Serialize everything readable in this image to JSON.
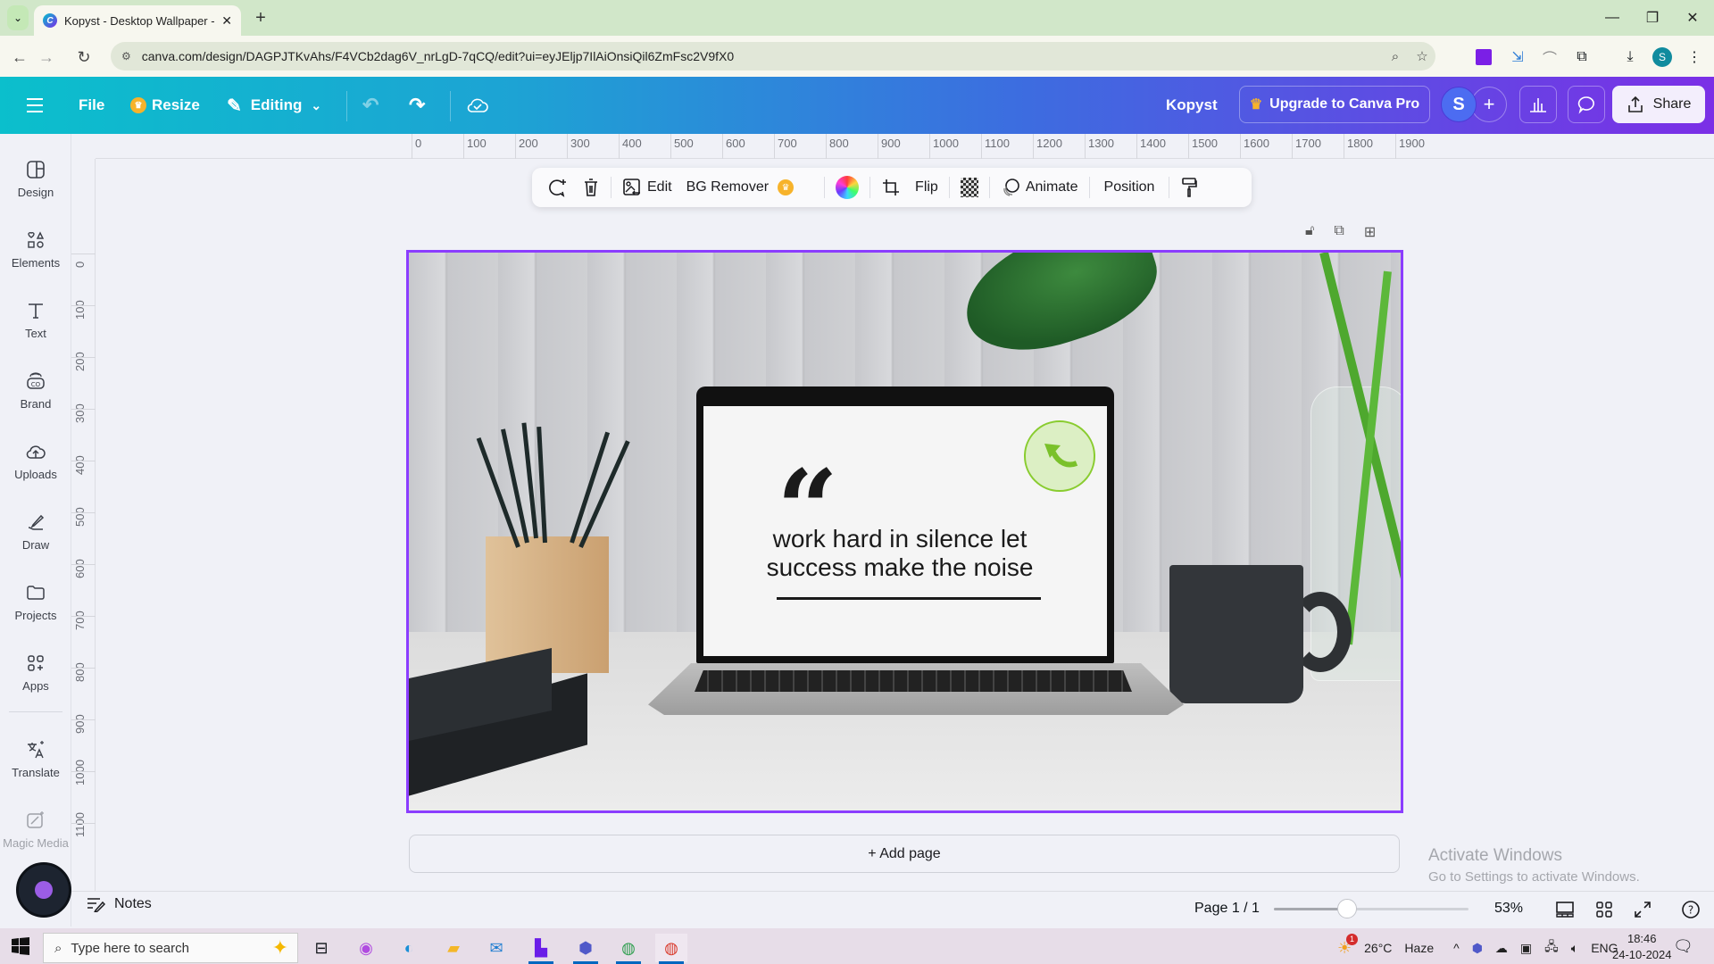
{
  "browser": {
    "tab_title": "Kopyst - Desktop Wallpaper - C",
    "url": "canva.com/design/DAGPJTKvAhs/F4VCb2dag6V_nrLgD-7qCQ/edit?ui=eyJEljp7IlAiOnsiQil6ZmFsc2V9fX0",
    "profile_initial": "S"
  },
  "header": {
    "file": "File",
    "resize": "Resize",
    "editing": "Editing",
    "doc_title": "Kopyst",
    "upgrade": "Upgrade to Canva Pro",
    "avatar_initial": "S",
    "share": "Share"
  },
  "sidebar": {
    "items": [
      {
        "label": "Design"
      },
      {
        "label": "Elements"
      },
      {
        "label": "Text"
      },
      {
        "label": "Brand"
      },
      {
        "label": "Uploads"
      },
      {
        "label": "Draw"
      },
      {
        "label": "Projects"
      },
      {
        "label": "Apps"
      },
      {
        "label": "Translate"
      },
      {
        "label": "Magic Media"
      }
    ]
  },
  "rulers": {
    "top": [
      "0",
      "100",
      "200",
      "300",
      "400",
      "500",
      "600",
      "700",
      "800",
      "900",
      "1000",
      "1100",
      "1200",
      "1300",
      "1400",
      "1500",
      "1600",
      "1700",
      "1800",
      "1900"
    ],
    "left": [
      "0",
      "100",
      "200",
      "300",
      "400",
      "500",
      "600",
      "700",
      "800",
      "900",
      "1000",
      "1100"
    ]
  },
  "toolbar": {
    "edit": "Edit",
    "bg_remover": "BG Remover",
    "flip": "Flip",
    "animate": "Animate",
    "position": "Position"
  },
  "design": {
    "quote_mark": "“",
    "quote_text": "work hard in silence let success make the noise"
  },
  "canvas": {
    "add_page": "+ Add page"
  },
  "watermark": {
    "line1": "Activate Windows",
    "line2": "Go to Settings to activate Windows."
  },
  "footer": {
    "notes": "Notes",
    "page_indicator": "Page 1 / 1",
    "zoom_value": "53%",
    "zoom_fraction": 0.53
  },
  "taskbar": {
    "search_placeholder": "Type here to search",
    "weather_temp": "26°C",
    "weather_desc": "Haze",
    "weather_badge": "1",
    "language": "ENG",
    "time": "18:46",
    "date": "24-10-2024"
  },
  "colors": {
    "selection": "#8b3dff",
    "header_start": "#0bbfcc",
    "header_end": "#7b2fe6",
    "crown": "#f7b32b",
    "badge_green": "#89cc2f"
  }
}
